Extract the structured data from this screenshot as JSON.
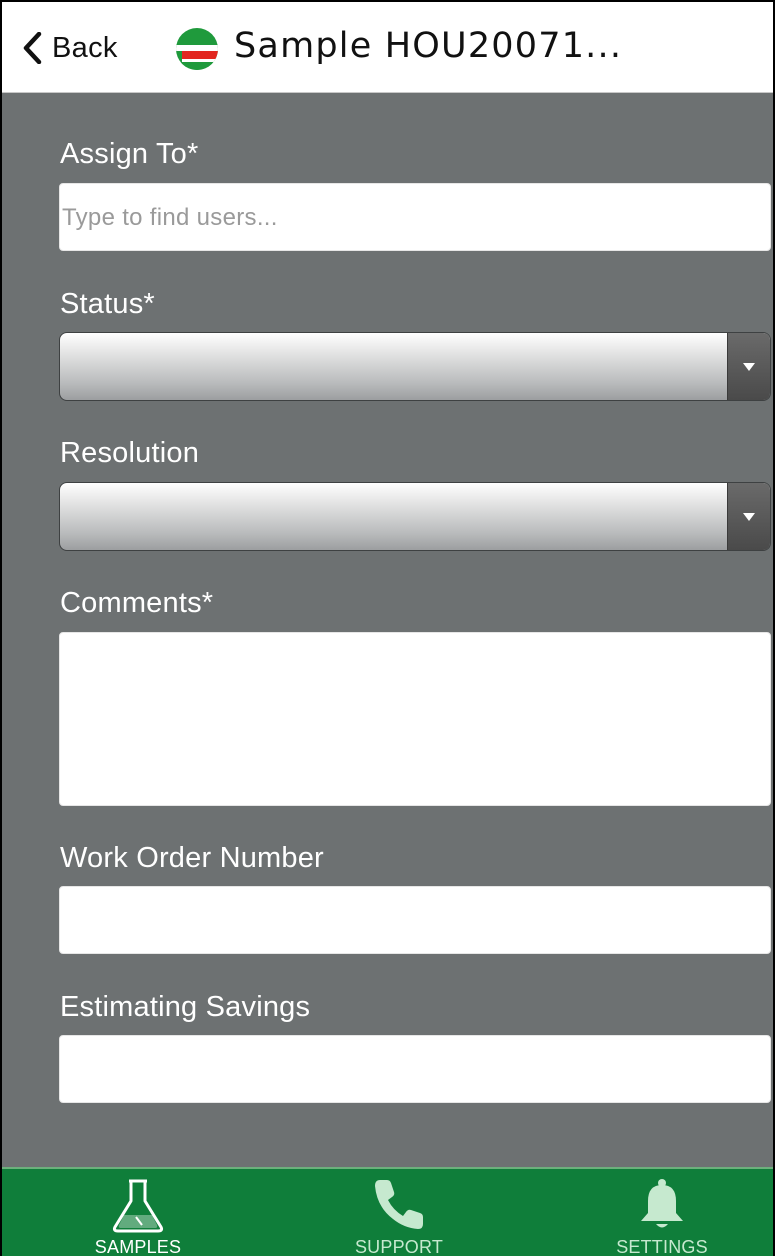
{
  "header": {
    "back_label": "Back",
    "title": "Sample HOU20071..."
  },
  "form": {
    "assign_to": {
      "label": "Assign To*",
      "placeholder": "Type to find users...",
      "value": ""
    },
    "status": {
      "label": "Status*",
      "selected": ""
    },
    "resolution": {
      "label": "Resolution",
      "selected": ""
    },
    "comments": {
      "label": "Comments*",
      "value": ""
    },
    "work_order_number": {
      "label": "Work Order Number",
      "value": ""
    },
    "estimating_savings": {
      "label": "Estimating Savings",
      "value": ""
    }
  },
  "tabbar": {
    "tabs": [
      {
        "label": "SAMPLES",
        "icon": "flask-icon",
        "active": true
      },
      {
        "label": "SUPPORT",
        "icon": "phone-icon",
        "active": false
      },
      {
        "label": "SETTINGS",
        "icon": "bell-icon",
        "active": false
      }
    ]
  },
  "colors": {
    "form_background": "#6d7172",
    "tabbar_background": "#0f7e3a",
    "tab_inactive": "#c6e9cf",
    "logo_green": "#1f9a3c",
    "logo_red": "#e2261f"
  }
}
